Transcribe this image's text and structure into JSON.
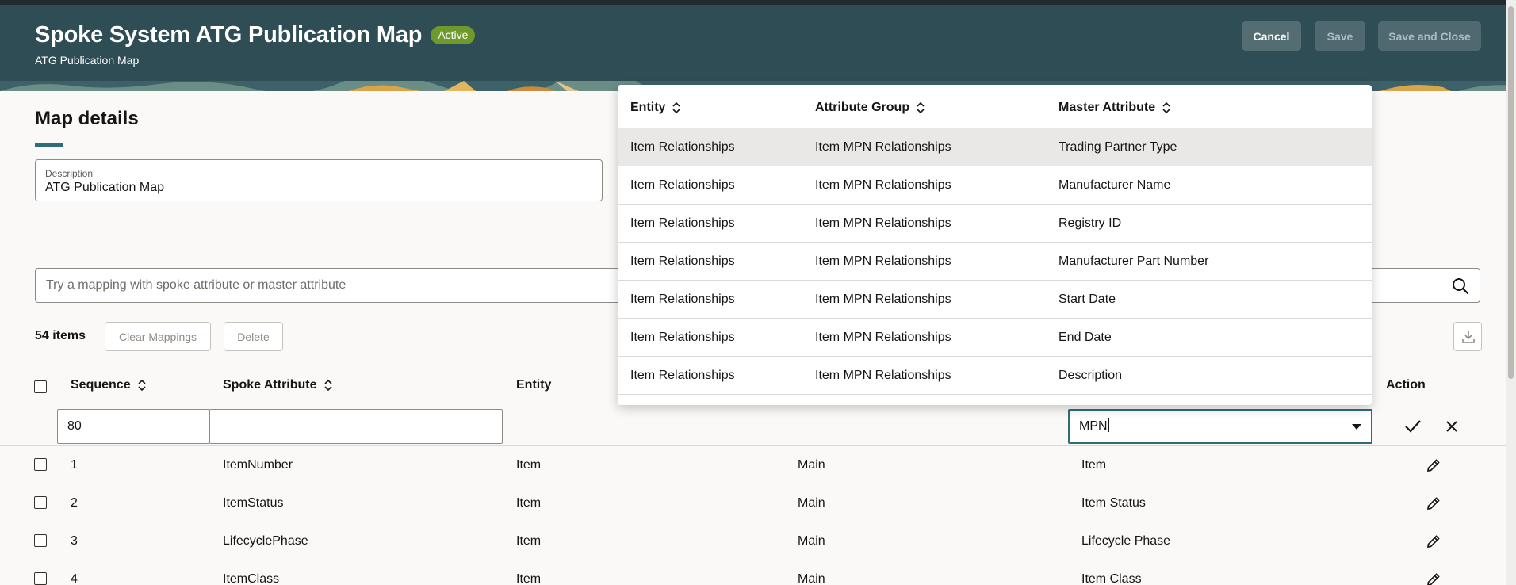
{
  "header": {
    "title": "Spoke System ATG Publication Map",
    "status": "Active",
    "subtitle": "ATG Publication Map",
    "cancel_label": "Cancel",
    "save_label": "Save",
    "save_close_label": "Save and Close"
  },
  "details": {
    "section_title": "Map details",
    "description_label": "Description",
    "description_value": "ATG Publication Map"
  },
  "search": {
    "placeholder": "Try a mapping with spoke attribute or master attribute",
    "icon": "search-icon"
  },
  "toolbar": {
    "count": "54 items",
    "clear_label": "Clear Mappings",
    "delete_label": "Delete",
    "download_icon": "download-icon"
  },
  "table": {
    "headers": {
      "sequence": "Sequence",
      "spoke_attribute": "Spoke Attribute",
      "entity": "Entity",
      "action": "Action"
    },
    "edit_row": {
      "sequence": "80",
      "spoke_attribute": "",
      "master_attribute": "MPN"
    },
    "rows": [
      {
        "sequence": "1",
        "spoke_attribute": "ItemNumber",
        "entity": "Item",
        "group": "Main",
        "master": "Item"
      },
      {
        "sequence": "2",
        "spoke_attribute": "ItemStatus",
        "entity": "Item",
        "group": "Main",
        "master": "Item Status"
      },
      {
        "sequence": "3",
        "spoke_attribute": "LifecyclePhase",
        "entity": "Item",
        "group": "Main",
        "master": "Lifecycle Phase"
      },
      {
        "sequence": "4",
        "spoke_attribute": "ItemClass",
        "entity": "Item",
        "group": "Main",
        "master": "Item Class"
      }
    ]
  },
  "popup": {
    "headers": {
      "entity": "Entity",
      "attribute_group": "Attribute Group",
      "master_attribute": "Master Attribute"
    },
    "rows": [
      {
        "entity": "Item Relationships",
        "group": "Item MPN Relationships",
        "master": "Trading Partner Type"
      },
      {
        "entity": "Item Relationships",
        "group": "Item MPN Relationships",
        "master": "Manufacturer Name"
      },
      {
        "entity": "Item Relationships",
        "group": "Item MPN Relationships",
        "master": "Registry ID"
      },
      {
        "entity": "Item Relationships",
        "group": "Item MPN Relationships",
        "master": "Manufacturer Part Number"
      },
      {
        "entity": "Item Relationships",
        "group": "Item MPN Relationships",
        "master": "Start Date"
      },
      {
        "entity": "Item Relationships",
        "group": "Item MPN Relationships",
        "master": "End Date"
      },
      {
        "entity": "Item Relationships",
        "group": "Item MPN Relationships",
        "master": "Description"
      }
    ]
  },
  "colors": {
    "header_bg": "#2f4d55",
    "badge": "#6e9a2c",
    "accent": "#2f6d77"
  }
}
